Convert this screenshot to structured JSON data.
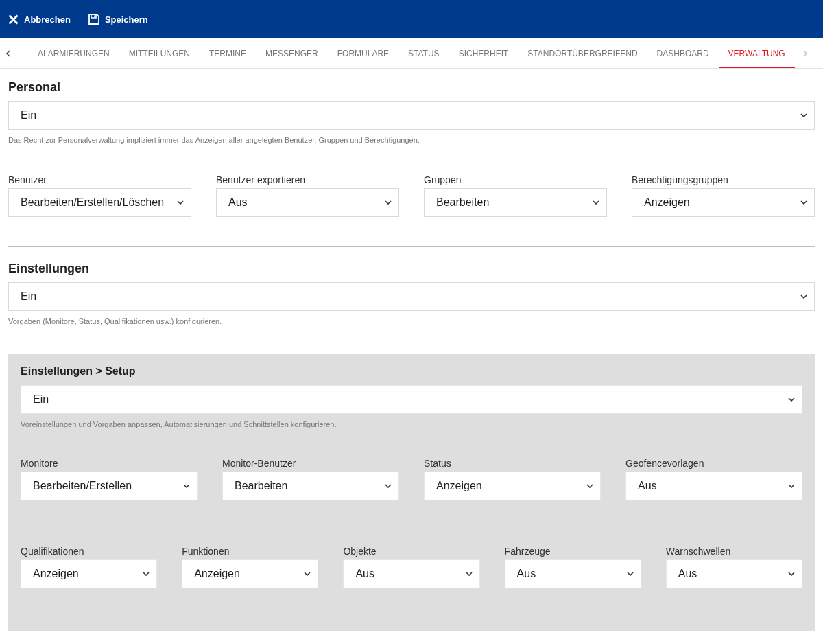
{
  "toolbar": {
    "buttons": [
      {
        "kind": "cancel",
        "label": "Abbrechen"
      },
      {
        "kind": "save",
        "label": "Speichern"
      }
    ]
  },
  "tabs": {
    "scroll_buttons": [
      {
        "kind": "left",
        "disabled": false
      },
      {
        "kind": "right",
        "disabled": true
      }
    ],
    "items": [
      {
        "label": "ALARMIERUNGEN",
        "selected": false
      },
      {
        "label": "MITTEILUNGEN",
        "selected": false
      },
      {
        "label": "TERMINE",
        "selected": false
      },
      {
        "label": "MESSENGER",
        "selected": false
      },
      {
        "label": "FORMULARE",
        "selected": false
      },
      {
        "label": "STATUS",
        "selected": false
      },
      {
        "label": "SICHERHEIT",
        "selected": false
      },
      {
        "label": "STANDORTÜBERGREIFEND",
        "selected": false
      },
      {
        "label": "DASHBOARD",
        "selected": false
      },
      {
        "label": "VERWALTUNG",
        "selected": true
      }
    ]
  },
  "sections": [
    {
      "title": "Personal",
      "select": {
        "value": "Ein"
      },
      "hint": "Das Recht zur Personalverwaltung impliziert immer das Anzeigen aller angelegten Benutzer, Gruppen und Berechtigungen.",
      "field_rows": [
        [
          {
            "label": "Benutzer",
            "value": "Bearbeiten/Erstellen/Löschen"
          },
          {
            "label": "Benutzer exportieren",
            "value": "Aus"
          },
          {
            "label": "Gruppen",
            "value": "Bearbeiten"
          },
          {
            "label": "Berechtigungsgruppen",
            "value": "Anzeigen"
          }
        ]
      ]
    },
    {
      "title": "Einstellungen",
      "select": {
        "value": "Ein"
      },
      "hint": "Vorgaben (Monitore, Status, Qualifikationen usw.) konfigurieren.",
      "panel": {
        "title": "Einstellungen > Setup",
        "select": {
          "value": "Ein"
        },
        "hint": "Voreinstellungen und Vorgaben anpassen, Automatisierungen und Schnittstellen konfigurieren.",
        "field_rows": [
          [
            {
              "label": "Monitore",
              "value": "Bearbeiten/Erstellen"
            },
            {
              "label": "Monitor-Benutzer",
              "value": "Bearbeiten"
            },
            {
              "label": "Status",
              "value": "Anzeigen"
            },
            {
              "label": "Geofencevorlagen",
              "value": "Aus"
            }
          ],
          [
            {
              "label": "Qualifikationen",
              "value": "Anzeigen"
            },
            {
              "label": "Funktionen",
              "value": "Anzeigen"
            },
            {
              "label": "Objekte",
              "value": "Aus"
            },
            {
              "label": "Fahrzeuge",
              "value": "Aus"
            },
            {
              "label": "Warnschwellen",
              "value": "Aus"
            }
          ]
        ]
      }
    }
  ]
}
